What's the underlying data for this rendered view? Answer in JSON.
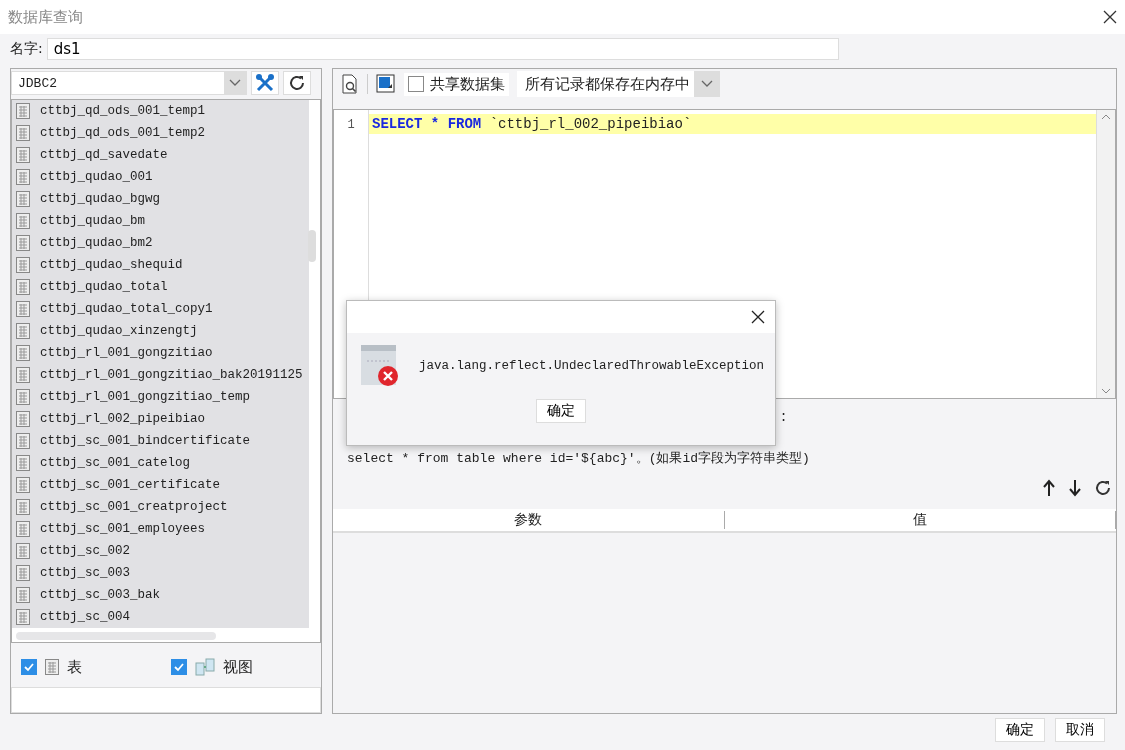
{
  "window": {
    "title": "数据库查询"
  },
  "name_field": {
    "label": "名字:",
    "value": "ds1"
  },
  "connection": {
    "value": "JDBC2"
  },
  "tables": [
    {
      "name": "cttbj_qd_ods_001_temp1",
      "selected": true
    },
    {
      "name": "cttbj_qd_ods_001_temp2",
      "selected": true
    },
    {
      "name": "cttbj_qd_savedate",
      "selected": true
    },
    {
      "name": "cttbj_qudao_001",
      "selected": true
    },
    {
      "name": "cttbj_qudao_bgwg",
      "selected": true
    },
    {
      "name": "cttbj_qudao_bm",
      "selected": true
    },
    {
      "name": "cttbj_qudao_bm2",
      "selected": true
    },
    {
      "name": "cttbj_qudao_shequid",
      "selected": true
    },
    {
      "name": "cttbj_qudao_total",
      "selected": true
    },
    {
      "name": "cttbj_qudao_total_copy1",
      "selected": true
    },
    {
      "name": "cttbj_qudao_xinzengtj",
      "selected": true
    },
    {
      "name": "cttbj_rl_001_gongzitiao",
      "selected": true
    },
    {
      "name": "cttbj_rl_001_gongzitiao_bak20191125",
      "selected": true
    },
    {
      "name": "cttbj_rl_001_gongzitiao_temp",
      "selected": true
    },
    {
      "name": "cttbj_rl_002_pipeibiao",
      "selected": true
    },
    {
      "name": "cttbj_sc_001_bindcertificate",
      "selected": true
    },
    {
      "name": "cttbj_sc_001_catelog",
      "selected": true
    },
    {
      "name": "cttbj_sc_001_certificate",
      "selected": true
    },
    {
      "name": "cttbj_sc_001_creatproject",
      "selected": true
    },
    {
      "name": "cttbj_sc_001_employees",
      "selected": true
    },
    {
      "name": "cttbj_sc_002",
      "selected": true
    },
    {
      "name": "cttbj_sc_003",
      "selected": true
    },
    {
      "name": "cttbj_sc_003_bak",
      "selected": true
    },
    {
      "name": "cttbj_sc_004",
      "selected": true
    }
  ],
  "filters": [
    {
      "label": "表",
      "checked": true,
      "kind": "table"
    },
    {
      "label": "视图",
      "checked": true,
      "kind": "view"
    }
  ],
  "toolbar": {
    "share_label": "共享数据集",
    "share_checked": false,
    "storage": "所有记录都保存在内存中"
  },
  "editor": {
    "lines": [
      {
        "number": "1",
        "keywords": [
          "SELECT",
          "*",
          "FROM"
        ],
        "rest": "`cttbj_rl_002_pipeibiao`"
      }
    ]
  },
  "hint": {
    "tail": ":",
    "example": "select * from table where id='${abc}'。(如果id字段为字符串类型)"
  },
  "params_table": {
    "columns": [
      "参数",
      "值"
    ]
  },
  "buttons": [
    "确定",
    "取消"
  ],
  "error_dialog": {
    "message": "java.lang.reflect.UndeclaredThrowableException",
    "button": "确定"
  }
}
